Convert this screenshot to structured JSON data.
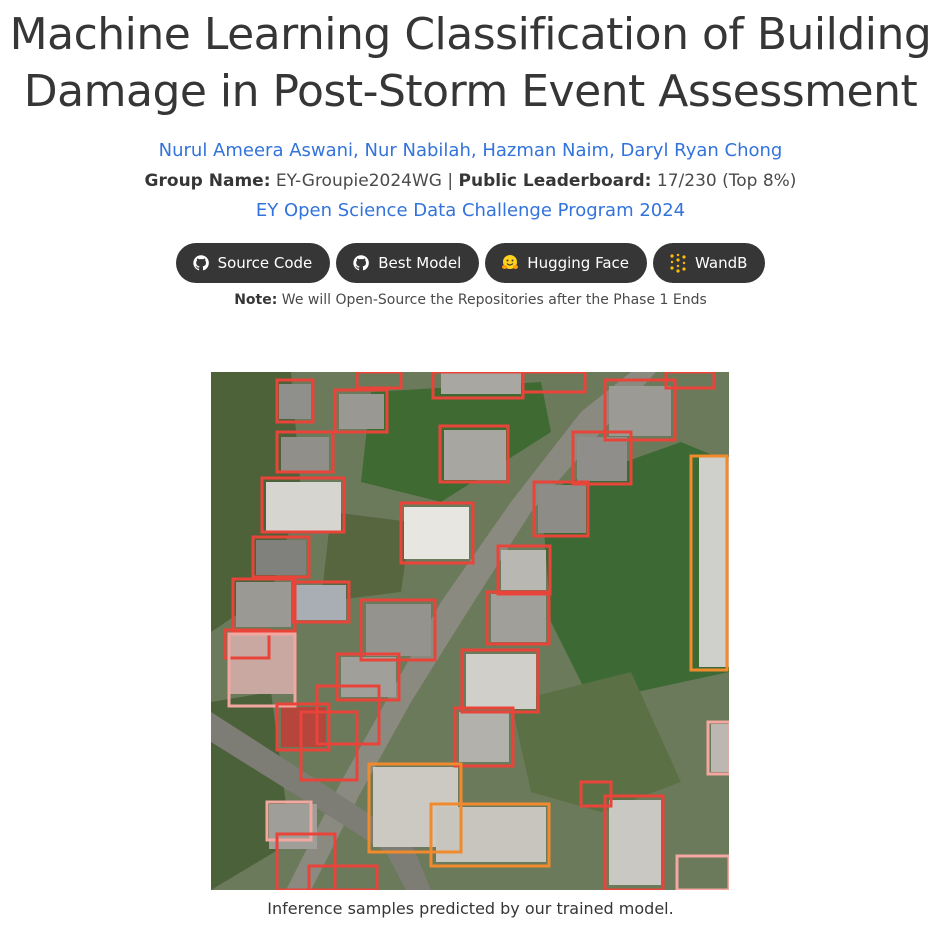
{
  "title": {
    "line1": "Machine Learning Classification of Building",
    "line2": "Damage in Post-Storm Event Assessment"
  },
  "authors": [
    "Nurul Ameera Aswani",
    "Nur Nabilah",
    "Hazman Naim",
    "Daryl Ryan Chong"
  ],
  "group": {
    "name_label": "Group Name:",
    "name_value": "EY-Groupie2024WG",
    "divider": "|",
    "leaderboard_label": "Public Leaderboard:",
    "leaderboard_value": "17/230 (Top 8%)"
  },
  "program": "EY Open Science Data Challenge Program 2024",
  "buttons": [
    {
      "label": "Source Code",
      "icon": "github-icon"
    },
    {
      "label": "Best Model",
      "icon": "github-icon"
    },
    {
      "label": "Hugging Face",
      "icon": "hugging-face-icon"
    },
    {
      "label": "WandB",
      "icon": "wandb-icon"
    }
  ],
  "note": {
    "label": "Note:",
    "text": "We will Open-Source the Repositories after the Phase 1 Ends"
  },
  "caption": "Inference samples predicted by our trained model.",
  "colors": {
    "link": "#3273dc",
    "button_bg": "#363636",
    "box_red": "#e8443a",
    "box_orange": "#f08a2c",
    "box_pink": "#f2a7a0"
  }
}
